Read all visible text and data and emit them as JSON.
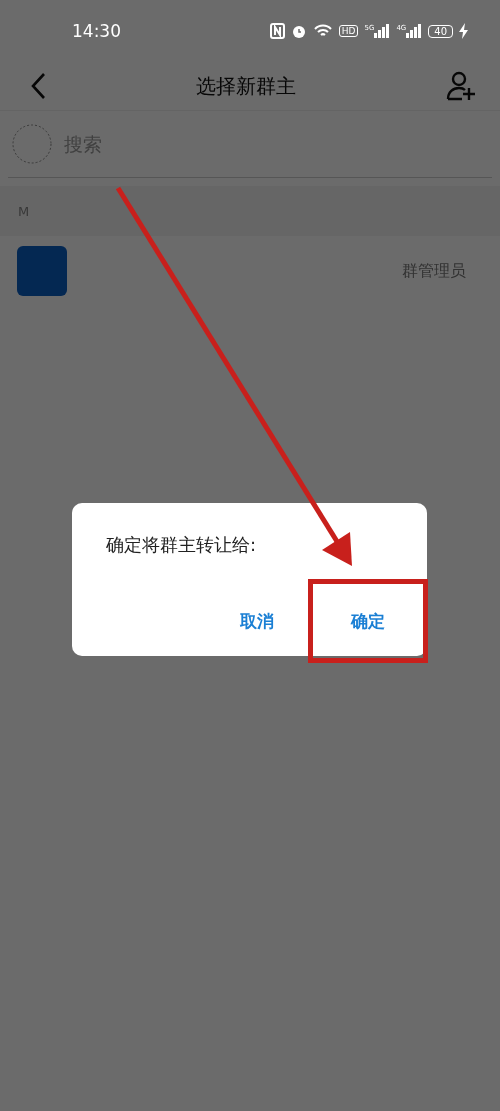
{
  "status_bar": {
    "time": "14:30",
    "hd": "HD",
    "signals": [
      "5G",
      "4G"
    ],
    "battery": "40"
  },
  "header": {
    "title": "选择新群主"
  },
  "search": {
    "placeholder": "搜索"
  },
  "sections": [
    {
      "letter": "M",
      "members": [
        {
          "role": "群管理员"
        }
      ]
    }
  ],
  "dialog": {
    "message": "确定将群主转让给:",
    "buttons": [
      {
        "label": "取消",
        "highlighted": false
      },
      {
        "label": "确定",
        "highlighted": true
      }
    ]
  }
}
